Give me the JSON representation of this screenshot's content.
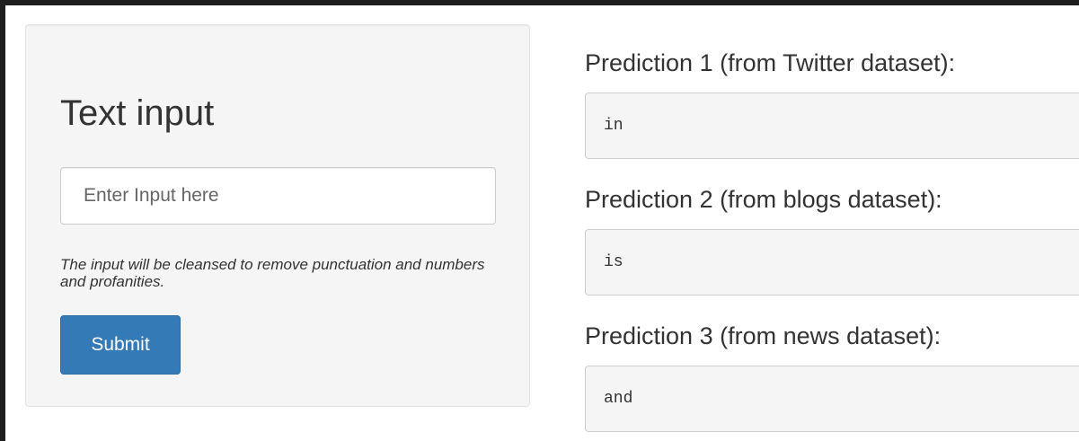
{
  "input_panel": {
    "title": "Text input",
    "input_value": "",
    "input_placeholder": "Enter Input here",
    "help_text": "The input will be cleansed to remove punctuation and numbers and profanities.",
    "submit_label": "Submit"
  },
  "predictions": [
    {
      "label": "Prediction 1 (from Twitter dataset):",
      "value": "in"
    },
    {
      "label": "Prediction 2 (from blogs dataset):",
      "value": "is"
    },
    {
      "label": "Prediction 3 (from news dataset):",
      "value": "and"
    }
  ],
  "colors": {
    "panel_background": "#f5f5f5",
    "primary_button": "#337ab7",
    "text": "#333333",
    "page_frame": "#1e1e1e"
  }
}
